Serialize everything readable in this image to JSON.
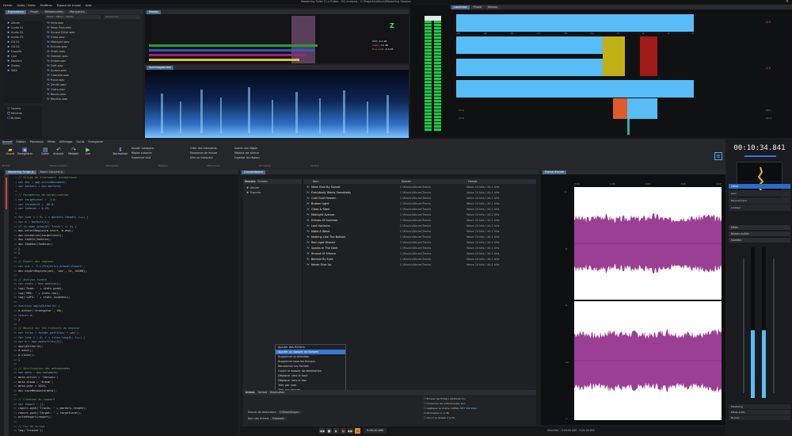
{
  "window": {
    "title": "Mastering Suite 11.x  Editor - EQ analysis - C:\\Projects\\Album\\Mastering Session",
    "menu": [
      "Fichier",
      "Audio / Vidéo",
      "Fenêtres",
      "Espace de travail",
      "Aide"
    ]
  },
  "top_left": {
    "tabs": [
      "Explorateur",
      "Projet",
      "Métadonnées",
      "Marqueurs"
    ],
    "path_value": "Music  ›  Album  ›  Tracks",
    "search_placeholder": "Rechercher",
    "folders": [
      "Album",
      "Audio 01",
      "Audio 02",
      "Audio 03",
      "CD 01",
      "CD 02",
      "Exports",
      "Live",
      "Masters",
      "Stems",
      "WAV"
    ],
    "files": [
      "Intro.wav",
      "Neon Rain.wav",
      "Sunset Drive.wav",
      "Glass.wav",
      "Midnight.wav",
      "Echoes.wav",
      "Static.wav",
      "Horizon.wav",
      "Ember.wav",
      "Drift.wav",
      "Aurora.wav",
      "Cascade.wav",
      "Pulse.wav",
      "Zenith.wav",
      "Outro.wav",
      "Bonus.wav",
      "Reprise.wav"
    ],
    "bottom_items": [
      "Favoris",
      "Récents",
      "Bureau"
    ]
  },
  "top_mid": {
    "tab": "Niveau",
    "labels": [
      "RMS",
      "Crête",
      "True peak"
    ],
    "values": [
      "-4.2 dB",
      "-1.0 dB",
      "-0.3 dB"
    ]
  },
  "spectrum_tab": "Spectrogramme",
  "meters_top": {
    "tabs": [
      "Loudness",
      "Phase",
      "Niveau"
    ],
    "scale": [
      "0",
      "-3",
      "-6",
      "-9",
      "-12",
      "-18",
      "-24",
      "-30",
      "-40",
      "-60"
    ],
    "big_values": [
      "-4.9",
      "-4.8"
    ],
    "phase_values": [
      "-17.0",
      "-17.8",
      "-20.1",
      "-22.4"
    ]
  },
  "timecode": "00:10:34.841",
  "ribbon": {
    "tabs": [
      "Accueil",
      "Édition",
      "Processus",
      "Effets",
      "Affichage",
      "Outils",
      "Enregistrer"
    ],
    "buttons": [
      "Ouvrir",
      "Enregistrer",
      "Coller",
      "Annuler",
      "Rétablir",
      "Lire",
      "Normaliser"
    ],
    "group_labels": [
      "Fichier",
      "Presse-papiers",
      "Navigation",
      "Régions",
      "Marqueurs",
      "Processus",
      "Lecture"
    ],
    "small": [
      "Ajouter marqueur",
      "Région suivante",
      "Supprimer tout",
      "Créer des marqueurs",
      "Marqueurs de lecture",
      "Aller au marqueur",
      "Insérer une région",
      "Régions par silence",
      "Exporter les régions"
    ]
  },
  "script_tabs": [
    "Mastering Script.js",
    "Batch Convert.js"
  ],
  "code_lines": [
    "// Script de traitement automatique",
    "var doc = app.activeDocument;",
    "var markers = doc.markers;",
    "",
    "// Paramètres de normalisation",
    "var targetLevel = -1.0;",
    "var threshold = -60.0;",
    "var fadeLen = 0.25;",
    "",
    "for (var i = 0; i < markers.length; i++) {",
    "  var m = markers[i];",
    "  if (m.name.indexOf('Track') >= 0) {",
    "    doc.selectRegion(m.start, m.end);",
    "    doc.normalize(targetLevel);",
    "    doc.fadeIn(fadeLen);",
    "    doc.fadeOut(fadeLen);",
    "  }",
    "}",
    "",
    "// Export des régions",
    "var out = 'C:\\\\Projects\\\\Album\\\\Export';",
    "doc.exportRegions(out, 'wav', 24, 44100);",
    "",
    "// Analyse finale",
    "var stats = doc.analyze();",
    "log('Peak: ' + stats.peak);",
    "log('RMS: ' + stats.rms);",
    "log('LUFS: ' + stats.loudness);",
    "",
    "function applyDither(d) {",
    "  d.dither('triangular', 16);",
    "  return d;",
    "}",
    "",
    "// Boucle sur les fichiers du dossier",
    "var files = folder.getFiles('*.wav');",
    "for (var f = 0; f < files.length; f++) {",
    "  var d = app.open(files[f]);",
    "  applyDither(d);",
    "  d.save();",
    "  d.close();",
    "}",
    "",
    "// Vérification des métadonnées",
    "var meta = doc.metadata;",
    "meta.artist = 'Various';",
    "meta.album = 'Album';",
    "meta.year = 2024;",
    "doc.saveMetadata(meta);",
    "",
    "// Création du rapport",
    "var report = [];",
    "report.push('Tracks: ' + markers.length);",
    "report.push('Target: ' + targetLevel);",
    "writeReport(report);",
    "",
    "// Fin du script",
    "log('Terminé');"
  ],
  "batch": {
    "tab": "Convertisseur",
    "left_tabs": [
      "Dossiers",
      "Fichiers"
    ],
    "left_items": [
      "Album",
      "Exports"
    ],
    "columns": [
      "Nom",
      "Dossier",
      "Format"
    ],
    "rows": [
      [
        "Neon Rain By Sunset",
        "C:\\Music\\Album\\Tracks",
        "Wave 24 bits / 44.1 kHz"
      ],
      [
        "Everybody Wants Somebody",
        "C:\\Music\\Album\\Tracks",
        "Wave 24 bits / 44.1 kHz"
      ],
      [
        "Cold Gold Heaven",
        "C:\\Music\\Album\\Tracks",
        "Wave 24 bits / 44.1 kHz"
      ],
      [
        "Broken Light",
        "C:\\Music\\Album\\Tracks",
        "Wave 24 bits / 44.1 kHz"
      ],
      [
        "Glass & Steel",
        "C:\\Music\\Album\\Tracks",
        "Wave 24 bits / 44.1 kHz"
      ],
      [
        "Midnight Avenue",
        "C:\\Music\\Album\\Tracks",
        "Wave 24 bits / 44.1 kHz"
      ],
      [
        "Echoes Of Summer",
        "C:\\Music\\Album\\Tracks",
        "Wave 24 bits / 44.1 kHz"
      ],
      [
        "Lost Horizons",
        "C:\\Music\\Album\\Tracks",
        "Wave 24 bits / 44.1 kHz"
      ],
      [
        "Make A Wave",
        "C:\\Music\\Album\\Tracks",
        "Wave 24 bits / 44.1 kHz"
      ],
      [
        "Nothing Like The Bottom",
        "C:\\Music\\Album\\Tracks",
        "Wave 24 bits / 44.1 kHz"
      ],
      [
        "Red Light District",
        "C:\\Music\\Album\\Tracks",
        "Wave 24 bits / 44.1 kHz"
      ],
      [
        "Sparks In The Dark",
        "C:\\Music\\Album\\Tracks",
        "Wave 24 bits / 44.1 kHz"
      ],
      [
        "Shroud Of Silence",
        "C:\\Music\\Album\\Tracks",
        "Wave 24 bits / 44.1 kHz"
      ],
      [
        "Behind My Eyes",
        "C:\\Music\\Album\\Tracks",
        "Wave 24 bits / 44.1 kHz"
      ],
      [
        "Never Give Up",
        "C:\\Music\\Album\\Tracks",
        "Wave 24 bits / 44.1 kHz"
      ]
    ],
    "context_menu": [
      "Ajouter des fichiers",
      "Ajouter un dossier de fichiers",
      "Supprimer la sélection",
      "Supprimer tous les fichiers",
      "Renommer les fichiers",
      "Ouvrir le dossier de destination",
      "Déplacer vers le haut",
      "Déplacer vers le bas",
      "Trier par nom",
      "Trier par dossier",
      "Propriétés"
    ],
    "context_highlight": 1,
    "bottom_tabs": [
      "Actions",
      "Format",
      "Destination"
    ],
    "bottom_fields": [
      "Dossier de destination",
      "Nom des fichiers"
    ],
    "bottom_values": [
      "C:\\Music\\Export",
      "%name%"
    ],
    "options": [
      "Écraser les fichiers existants",
      "Conserver les métadonnées",
      "Appliquer la chaîne d'effets",
      "Normaliser à -1 dB",
      "Ouvrir le dossier à la fin"
    ],
    "option_values": [
      "Oui",
      "Non",
      "MP3 320 kbps"
    ]
  },
  "waveform": {
    "tab": "Forme d'onde",
    "ruler": [
      "0:00",
      "1:00",
      "2:00",
      "3:00",
      "4:00"
    ],
    "db_scale": [
      "0",
      "-3",
      "-6",
      "-12",
      "-∞"
    ]
  },
  "transport": {
    "position": "0:00:10.000",
    "selection_label": "Sélection : 0:00:00.000 - 0:04:30.000"
  },
  "right_panel": {
    "sections": [
      "Canal",
      "Effets",
      "Niveau maître",
      "Vumètre"
    ],
    "items": [
      "Gain",
      "Panoramique",
      "Limiteur"
    ],
    "footer": [
      "Mastering",
      "Effets actifs",
      "Bypass"
    ]
  },
  "colors": {
    "accent": "#3876d1",
    "meter_blue": "#58bdf7",
    "meter_yellow": "#c1b016",
    "meter_red": "#a11a1a",
    "meter_orange": "#e05a2c",
    "waveform": "#9a3f93",
    "spectrum": "#2f6fc2",
    "level_green": "#24c54a"
  }
}
